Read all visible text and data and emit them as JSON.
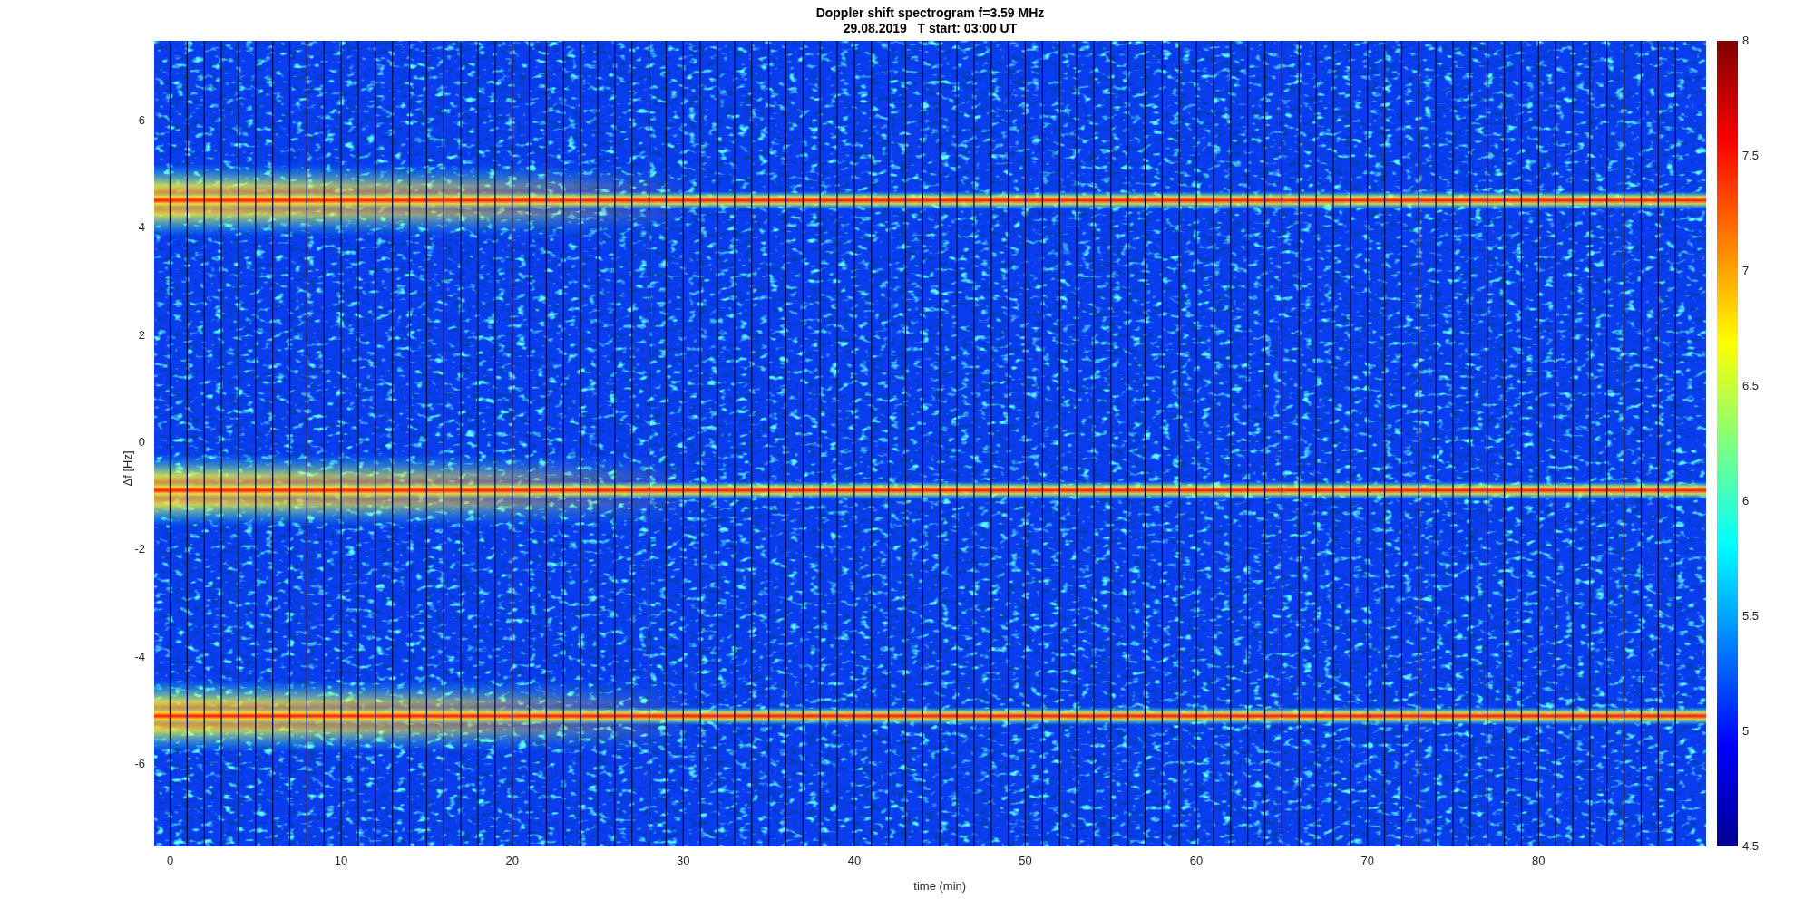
{
  "figure": {
    "title": "Doppler shift spectrogram f=3.59 MHz",
    "subtitle": "29.08.2019   T start: 03:00 UT"
  },
  "axes": {
    "xlabel": "time (min)",
    "ylabel": "Δf [Hz]",
    "xticks": [
      "0",
      "10",
      "20",
      "30",
      "40",
      "50",
      "60",
      "70",
      "80"
    ],
    "yticks": [
      "6",
      "4",
      "2",
      "0",
      "-2",
      "-4",
      "-6"
    ]
  },
  "colorbar": {
    "ticks": [
      "8",
      "7.5",
      "7",
      "6.5",
      "6",
      "5.5",
      "5",
      "4.5"
    ]
  }
}
